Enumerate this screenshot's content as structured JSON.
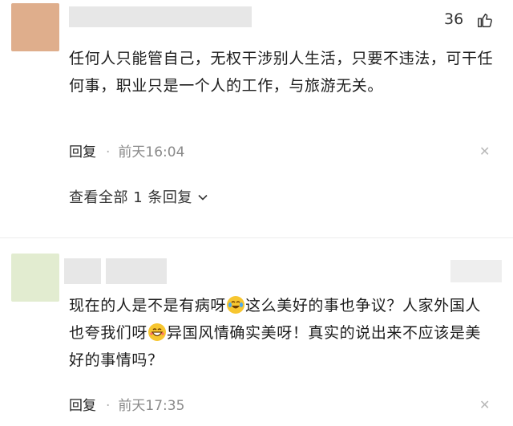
{
  "comments": [
    {
      "likes": "36",
      "text": "任何人只能管自己，无权干涉别人生活，只要不违法，可干任何事，职业只是一个人的工作，与旅游无关。",
      "reply_label": "回复",
      "time": "前天16:04",
      "expand_label": "查看全部 1 条回复",
      "avatar_color": "#dfae8c"
    },
    {
      "text_parts": [
        "现在的人是不是有病呀",
        "这么美好的事也争议？人家外国人也夸我们呀",
        "异国风情确实美呀！真实的说出来不应该是美好的事情吗？"
      ],
      "reply_label": "回复",
      "time": "前天17:35",
      "avatar_color": "#e2ecd0"
    }
  ],
  "icons": {
    "like": "thumbs-up-icon",
    "close": "close-icon",
    "chevron": "chevron-down-icon",
    "emoji1": "laughing-crying-emoji",
    "emoji2": "grinning-emoji"
  }
}
